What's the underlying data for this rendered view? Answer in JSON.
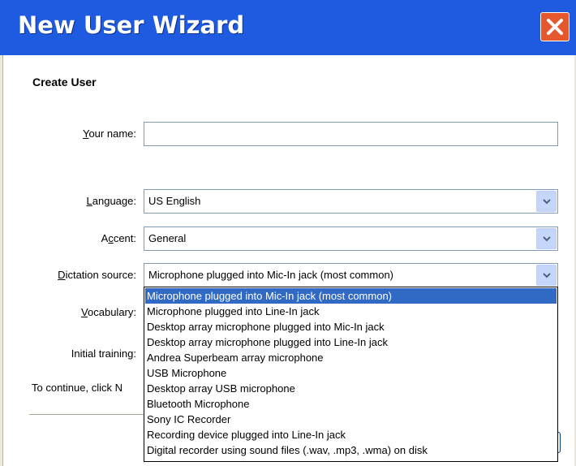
{
  "window": {
    "title": "New User Wizard",
    "close_icon": "close-icon"
  },
  "section": {
    "title": "Create User"
  },
  "form": {
    "your_name": {
      "label_key": "Y",
      "label_rest": "our name:",
      "value": ""
    },
    "language": {
      "label_key": "L",
      "label_rest": "anguage:",
      "value": "US English"
    },
    "accent": {
      "label_pre": "A",
      "label_key": "c",
      "label_rest": "cent:",
      "value": "General"
    },
    "dictation_source": {
      "label_key": "D",
      "label_rest": "ictation source:",
      "value": "Microphone plugged into Mic-In jack (most common)"
    },
    "vocabulary": {
      "label_key": "V",
      "label_rest": "ocabulary:"
    },
    "initial_training": {
      "label": "Initial training:"
    },
    "continue_text": "To continue, click N"
  },
  "dropdown": {
    "options": [
      "Microphone plugged into Mic-In jack (most common)",
      "Microphone plugged into Line-In jack",
      "Desktop array microphone plugged into Mic-In jack",
      "Desktop array microphone plugged into Line-In jack",
      "Andrea Superbeam array microphone",
      "USB Microphone",
      "Desktop array USB microphone",
      "Bluetooth Microphone",
      "Sony IC Recorder",
      "Recording device plugged into Line-In jack",
      "Digital recorder using sound files (.wav, .mp3, .wma) on disk"
    ],
    "selected_index": 0
  },
  "colors": {
    "title_bar": "#1f5be0",
    "close_button": "#e5582e",
    "selection": "#316ac5"
  }
}
